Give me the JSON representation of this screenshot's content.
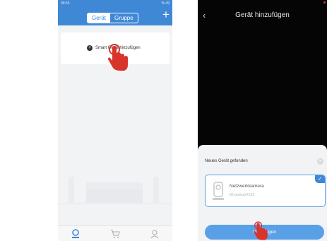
{
  "left_screen": {
    "status": {
      "time": "09:53",
      "battery": "% 49"
    },
    "tabs": [
      "Gerät",
      "Gruppe"
    ],
    "active_tab": 0,
    "plus_icon": "plus-icon",
    "add_device": {
      "icon": "plus-circle-icon",
      "label": "Smart Gerät hinzufügen"
    },
    "tabbar": [
      "home-icon",
      "cart-icon",
      "profile-icon"
    ]
  },
  "right_screen": {
    "title": "Gerät hinzufügen",
    "back_icon": "chevron-left-icon",
    "found_label": "Neues Gerät gefunden",
    "device": {
      "name": "Netzwerkkamera",
      "id": "ID:xxxxxxx7123"
    },
    "add_button_label": "Hinzufügen"
  },
  "colors": {
    "primary": "#3f88d6",
    "button": "#5aa0e6",
    "hand": "#d8342c"
  }
}
